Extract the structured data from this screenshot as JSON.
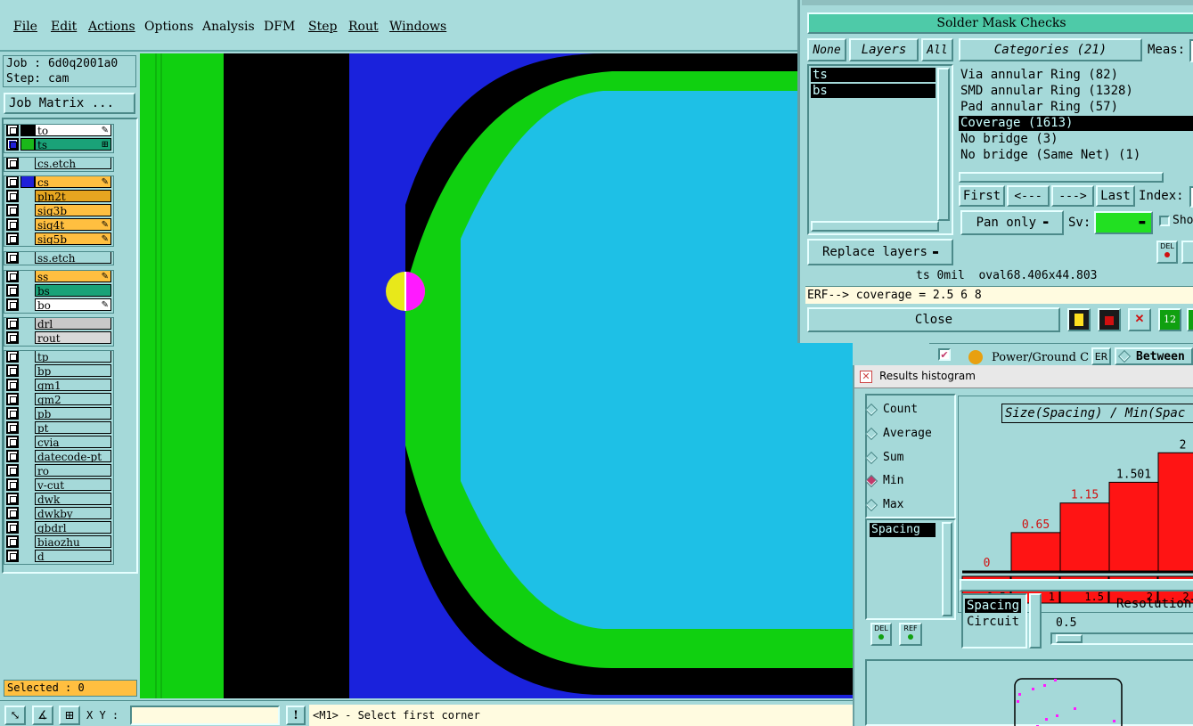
{
  "menubar": {
    "items": [
      {
        "label": "File"
      },
      {
        "label": "Edit"
      },
      {
        "label": "Actions"
      },
      {
        "label": "Options"
      },
      {
        "label": "Analysis"
      },
      {
        "label": "DFM"
      },
      {
        "label": "Step"
      },
      {
        "label": "Rout"
      },
      {
        "label": "Windows"
      }
    ]
  },
  "left_panel": {
    "job": "Job : 6d0q2001a0",
    "step": "Step: cam",
    "matrix_button": "Job Matrix ...",
    "selected": "Selected : 0",
    "layers": [
      {
        "name": "to",
        "color": "#ffffff",
        "swatch": "#000000",
        "mark": "✎"
      },
      {
        "name": "ts",
        "color": "#1aa278",
        "swatch": "#1ab81a",
        "mark": "⊞"
      },
      {
        "name": "cs.etch",
        "color": "#a5d9d9",
        "swatch": "",
        "mark": ""
      },
      {
        "name": "cs",
        "color": "#ffbf40",
        "swatch": "#2020d8",
        "mark": "✎"
      },
      {
        "name": "pln2t",
        "color": "#e6a520",
        "swatch": "",
        "mark": ""
      },
      {
        "name": "sig3b",
        "color": "#ffbf40",
        "swatch": "",
        "mark": ""
      },
      {
        "name": "sig4t",
        "color": "#ffbf40",
        "swatch": "",
        "mark": "✎"
      },
      {
        "name": "sig5b",
        "color": "#ffbf40",
        "swatch": "",
        "mark": "✎"
      },
      {
        "name": "ss.etch",
        "color": "#a5d9d9",
        "swatch": "",
        "mark": ""
      },
      {
        "name": "ss",
        "color": "#ffbf40",
        "swatch": "",
        "mark": "✎"
      },
      {
        "name": "bs",
        "color": "#1aa278",
        "swatch": "",
        "mark": ""
      },
      {
        "name": "bo",
        "color": "#ffffff",
        "swatch": "",
        "mark": "✎"
      },
      {
        "name": "drl",
        "color": "#c8c8c8",
        "swatch": "",
        "mark": ""
      },
      {
        "name": "rout",
        "color": "#d8d8d8",
        "swatch": "",
        "mark": ""
      },
      {
        "name": "tp",
        "color": "#a5d9d9",
        "swatch": "",
        "mark": ""
      },
      {
        "name": "bp",
        "color": "#a5d9d9",
        "swatch": "",
        "mark": ""
      },
      {
        "name": "gm1",
        "color": "#a5d9d9",
        "swatch": "",
        "mark": ""
      },
      {
        "name": "gm2",
        "color": "#a5d9d9",
        "swatch": "",
        "mark": ""
      },
      {
        "name": "pb",
        "color": "#a5d9d9",
        "swatch": "",
        "mark": ""
      },
      {
        "name": "pt",
        "color": "#a5d9d9",
        "swatch": "",
        "mark": ""
      },
      {
        "name": "cvia",
        "color": "#a5d9d9",
        "swatch": "",
        "mark": ""
      },
      {
        "name": "datecode-pt",
        "color": "#a5d9d9",
        "swatch": "",
        "mark": ""
      },
      {
        "name": "ro",
        "color": "#a5d9d9",
        "swatch": "",
        "mark": ""
      },
      {
        "name": "v-cut",
        "color": "#a5d9d9",
        "swatch": "",
        "mark": ""
      },
      {
        "name": "dwk",
        "color": "#a5d9d9",
        "swatch": "",
        "mark": ""
      },
      {
        "name": "dwkby",
        "color": "#a5d9d9",
        "swatch": "",
        "mark": ""
      },
      {
        "name": "gbdrl",
        "color": "#a5d9d9",
        "swatch": "",
        "mark": ""
      },
      {
        "name": "biaozhu",
        "color": "#a5d9d9",
        "swatch": "",
        "mark": ""
      },
      {
        "name": "d",
        "color": "#a5d9d9",
        "swatch": "",
        "mark": ""
      }
    ]
  },
  "status_bar": {
    "xy_label": "X Y :",
    "xy_value": "",
    "alert": "!",
    "message": "<M1> - Select first corner"
  },
  "solder_mask": {
    "title": "Solder Mask Checks",
    "none_btn": "None",
    "layers_btn": "Layers",
    "all_btn": "All",
    "layers": [
      "ts",
      "bs"
    ],
    "categories_btn": "Categories (21)",
    "meas_label": "Meas:",
    "categories": [
      "Via annular Ring (82)",
      "SMD annular Ring (1328)",
      "Pad annular Ring (57)",
      "Coverage (1613)",
      "No bridge (3)",
      "No bridge (Same Net) (1)"
    ],
    "selected_category": 3,
    "nav": {
      "first": "First",
      "prev": "<---",
      "next": "--->",
      "last": "Last",
      "index": "Index:"
    },
    "pan_option": "Pan only",
    "sv_label": "Sv:",
    "show_label": "Sho",
    "del": "DEL",
    "replace_layers": "Replace layers",
    "info_line": "ts 0mil  oval68.406x44.803",
    "erf_line": "ERF--> coverage = 2.5 6 8",
    "close": "Close"
  },
  "toolbar2": {
    "power_ground": "Power/Ground C",
    "er": "ER",
    "between": "Between"
  },
  "histogram": {
    "title": "Results histogram",
    "radios": [
      {
        "label": "Count",
        "on": false
      },
      {
        "label": "Average",
        "on": false
      },
      {
        "label": "Sum",
        "on": false
      },
      {
        "label": "Min",
        "on": true
      },
      {
        "label": "Max",
        "on": false
      }
    ],
    "spacing_item": "Spacing",
    "del": "DEL",
    "ref": "REF",
    "chart_title": "Size(Spacing) / Min(Spac",
    "resolution_label": "Resolution",
    "resolution_value": "0.5",
    "list2": [
      "Spacing",
      "Circuit"
    ]
  },
  "chart_data": {
    "type": "bar",
    "categories": [
      "0-0.5",
      "0.5-1",
      "1-1.5",
      "1.5-2",
      "2-2.5"
    ],
    "values": [
      0,
      0.65,
      1.15,
      1.501,
      2
    ],
    "value_labels": [
      "0",
      "0.65",
      "1.15",
      "1.501",
      "2"
    ],
    "label_colors": [
      "#d01010",
      "#d01010",
      "#d01010",
      "#000000",
      "#000000"
    ],
    "ylim": [
      0,
      2.2
    ],
    "bar_color": "#ff1414"
  },
  "colors": {
    "canvas_black": "#000000",
    "canvas_blue": "#1a22dc",
    "canvas_green": "#10d010",
    "canvas_cyan": "#1ec0e6",
    "marker_yellow": "#e8e81a",
    "marker_magenta": "#ff1aff"
  }
}
